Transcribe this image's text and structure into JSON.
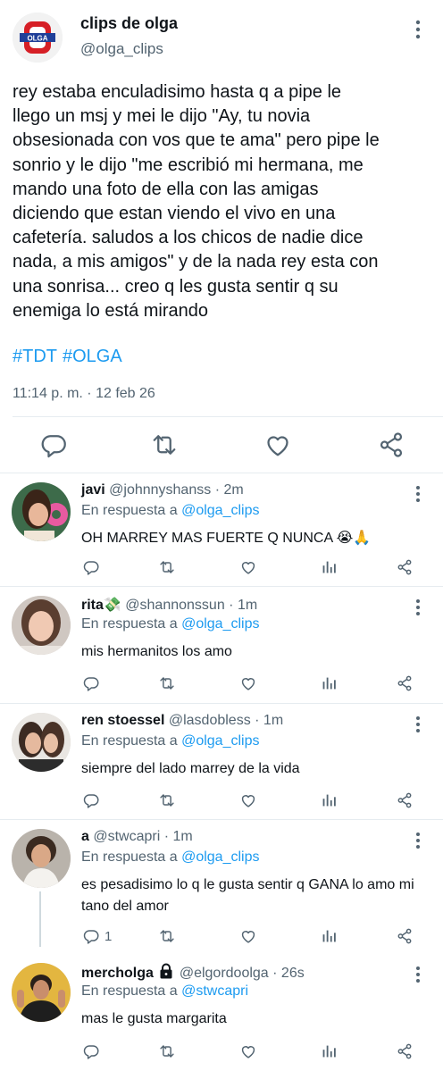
{
  "tweet": {
    "author_name": "clips de olga",
    "author_handle": "@olga_clips",
    "avatar_logo_text": "OLGA",
    "text": "rey estaba enculadisimo hasta q a pipe le\nllego un msj y mei le dijo \"Ay, tu novia\nobsesionada con vos que te ama\" pero pipe le\nsonrio y le dijo \"me escribió mi hermana, me\nmando una foto de ella con las amigas\ndiciendo que estan viendo el vivo en una\ncafetería. saludos a los chicos de nadie dice\nnada, a mis amigos\" y de la nada rey esta con\nuna sonrisa... creo q les gusta sentir q su\nenemiga lo está mirando",
    "hashtags": [
      "#TDT",
      "#OLGA"
    ],
    "timestamp": "11:14 p. m. · 12 feb 26"
  },
  "replies": [
    {
      "name": "javi",
      "handle": "@johnnyshanss",
      "time": "· 2m",
      "reply_prefix": "En respuesta a ",
      "reply_to": "@olga_clips",
      "text": "OH MARREY MAS FUERTE Q NUNCA 😭🙏",
      "reply_count": ""
    },
    {
      "name": "rita💸",
      "handle": "@shannonssun",
      "time": "· 1m",
      "reply_prefix": "En respuesta a ",
      "reply_to": "@olga_clips",
      "text": "mis hermanitos los amo",
      "reply_count": ""
    },
    {
      "name": "ren stoessel",
      "handle": "@lasdobless",
      "time": "· 1m",
      "reply_prefix": "En respuesta a ",
      "reply_to": "@olga_clips",
      "text": "siempre del lado marrey de la vida",
      "reply_count": ""
    },
    {
      "name": "a",
      "handle": "@stwcapri",
      "time": "· 1m",
      "reply_prefix": "En respuesta a ",
      "reply_to": "@olga_clips",
      "text": "es pesadisimo lo q le gusta sentir q GANA lo amo mi tano del amor",
      "reply_count": "1"
    },
    {
      "name": "mercholga",
      "handle": "@elgordoolga",
      "time": "· 26s",
      "reply_prefix": "En respuesta a ",
      "reply_to": "@stwcapri",
      "text": "mas le gusta margarita",
      "reply_count": "",
      "locked": true
    }
  ],
  "icons": {
    "reply": "reply-icon",
    "retweet": "retweet-icon",
    "like": "like-icon",
    "stats": "stats-icon",
    "share": "share-icon",
    "more": "more-icon",
    "lock": "lock-icon"
  },
  "colors": {
    "link": "#1d9bf0",
    "secondary": "#536471",
    "primary_text": "#0f1419",
    "divider": "#e6ecf0"
  }
}
